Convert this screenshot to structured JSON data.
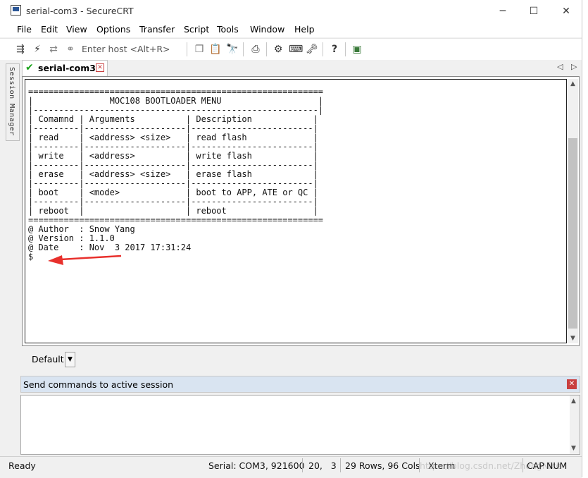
{
  "window": {
    "title": "serial-com3 - SecureCRT",
    "controls": [
      "─",
      "☐",
      "✕"
    ]
  },
  "menu": [
    "File",
    "Edit",
    "View",
    "Options",
    "Transfer",
    "Script",
    "Tools",
    "Window",
    "Help"
  ],
  "toolbar": {
    "host_placeholder": "Enter host <Alt+R>",
    "icons": [
      "connect-icon",
      "lightning-icon",
      "reconnect-icon",
      "disconnect-icon",
      "copy-icon",
      "paste-icon",
      "find-icon",
      "print-icon",
      "settings-icon",
      "keymap-icon",
      "key-icon",
      "help-icon",
      "sftp-icon"
    ]
  },
  "side_tab": {
    "label": "Session Manager"
  },
  "tabs": [
    {
      "label": "serial-com3",
      "active": true
    }
  ],
  "terminal": {
    "lines": [
      "==========================================================",
      "|               MOC108 BOOTLOADER MENU                   |",
      "|--------------------------------------------------------|",
      "| Comamnd | Arguments          | Description            |",
      "|---------|--------------------|------------------------|",
      "| read    | <address> <size>   | read flash             |",
      "|---------|--------------------|------------------------|",
      "| write   | <address>          | write flash            |",
      "|---------|--------------------|------------------------|",
      "| erase   | <address> <size>   | erase flash            |",
      "|---------|--------------------|------------------------|",
      "| boot    | <mode>             | boot to APP, ATE or QC |",
      "|---------|--------------------|------------------------|",
      "| reboot  |                    | reboot                 |",
      "==========================================================",
      "@ Author  : Snow Yang",
      "@ Version : 1.1.0",
      "@ Date    : Nov  3 2017 17:31:24",
      "$"
    ],
    "annotation_color": "#e8302c"
  },
  "button_bar": {
    "label": "Default"
  },
  "command_window": {
    "title": "Send commands to active session",
    "value": ""
  },
  "status": {
    "ready": "Ready",
    "connection": "Serial: COM3, 921600",
    "position": "20,   3",
    "size": "29 Rows, 96 Cols",
    "emulation": "Xterm",
    "caps": "CAP",
    "num": "NUM",
    "watermark": "https://blog.csdn.net/ZhengNice"
  }
}
